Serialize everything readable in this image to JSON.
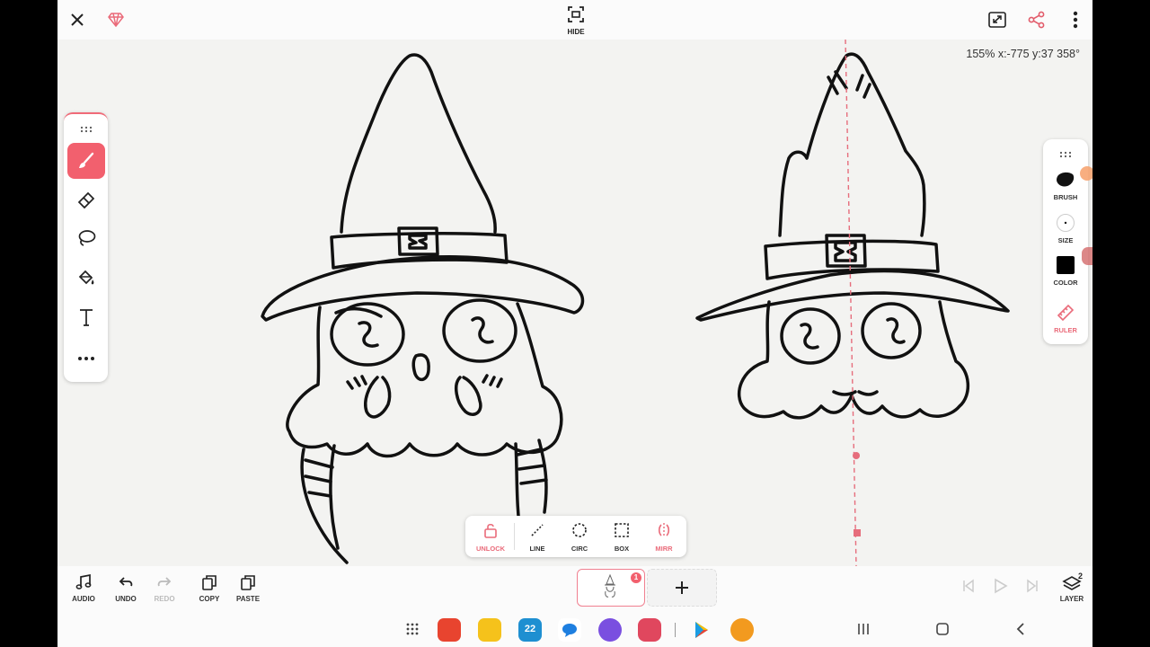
{
  "topbar": {
    "close_icon": "close-icon",
    "premium_icon": "diamond-icon",
    "hide_label": "HIDE",
    "expand_icon": "expand-icon",
    "share_icon": "share-icon",
    "more_icon": "more-vertical-icon"
  },
  "canvas": {
    "coords": "155% x:-775 y:37 358°"
  },
  "left_tools": [
    {
      "name": "brush",
      "icon": "brush-icon",
      "active": true
    },
    {
      "name": "eraser",
      "icon": "eraser-icon",
      "active": false
    },
    {
      "name": "lasso",
      "icon": "lasso-icon",
      "active": false
    },
    {
      "name": "fill",
      "icon": "fill-bucket-icon",
      "active": false
    },
    {
      "name": "text",
      "icon": "text-icon",
      "active": false
    },
    {
      "name": "more",
      "icon": "more-icon",
      "active": false
    }
  ],
  "right_tools": {
    "brush_label": "BRUSH",
    "size_label": "SIZE",
    "color_label": "COLOR",
    "ruler_label": "RULER",
    "current_color": "#000000",
    "accent": "#f2606e"
  },
  "shape_tools": {
    "unlock": "UNLOCK",
    "line": "LINE",
    "circ": "CIRC",
    "box": "BOX",
    "mirr": "MIRR"
  },
  "bottom": {
    "audio": "AUDIO",
    "undo": "UNDO",
    "redo": "REDO",
    "copy": "COPY",
    "paste": "PASTE",
    "frame_badge": "1",
    "layer": "LAYER",
    "layer_count": "2"
  },
  "nav": {
    "calendar_day": "22"
  }
}
